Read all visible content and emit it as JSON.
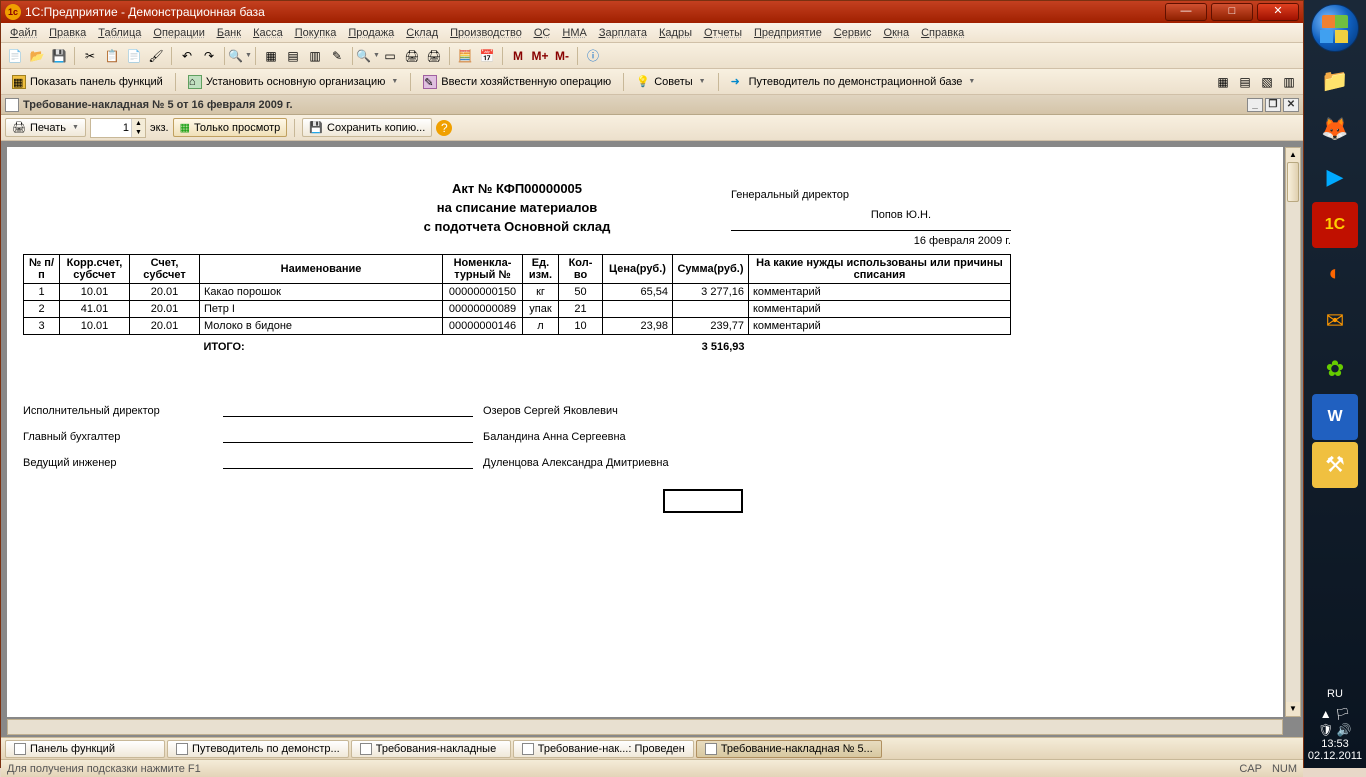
{
  "window": {
    "title": "1С:Предприятие - Демонстрационная база"
  },
  "menu": [
    "Файл",
    "Правка",
    "Таблица",
    "Операции",
    "Банк",
    "Касса",
    "Покупка",
    "Продажа",
    "Склад",
    "Производство",
    "ОС",
    "НМА",
    "Зарплата",
    "Кадры",
    "Отчеты",
    "Предприятие",
    "Сервис",
    "Окна",
    "Справка"
  ],
  "toolbar2": {
    "show_panel": "Показать панель функций",
    "set_org": "Установить основную организацию",
    "enter_op": "Ввести хозяйственную операцию",
    "tips": "Советы",
    "guide": "Путеводитель по демонстрационной базе"
  },
  "doc": {
    "tab_title": "Требование-накладная № 5 от 16 февраля 2009 г.",
    "print": "Печать",
    "copies": "1",
    "copies_suffix": "экз.",
    "view_only": "Только просмотр",
    "save_copy": "Сохранить копию..."
  },
  "act": {
    "number_line": "Акт № КФП00000005",
    "subtitle1": "на списание материалов",
    "subtitle2": "с подотчета Основной склад",
    "director_label": "Генеральный директор",
    "director_name": "Попов Ю.Н.",
    "date": "16 февраля 2009 г."
  },
  "table": {
    "headers": [
      "№ п/п",
      "Корр.счет, субсчет",
      "Счет, субсчет",
      "Наименование",
      "Номенкла-турный №",
      "Ед. изм.",
      "Кол-во",
      "Цена(руб.)",
      "Сумма(руб.)",
      "На какие нужды использованы или причины списания"
    ],
    "rows": [
      [
        "1",
        "10.01",
        "20.01",
        "Какао порошок",
        "00000000150",
        "кг",
        "50",
        "65,54",
        "3 277,16",
        "комментарий"
      ],
      [
        "2",
        "41.01",
        "20.01",
        "Петр I",
        "00000000089",
        "упак",
        "21",
        "",
        "",
        "комментарий"
      ],
      [
        "3",
        "10.01",
        "20.01",
        "Молоко в бидоне",
        "00000000146",
        "л",
        "10",
        "23,98",
        "239,77",
        "комментарий"
      ]
    ],
    "total_label": "ИТОГО:",
    "total_value": "3 516,93"
  },
  "signatures": [
    {
      "role": "Исполнительный директор",
      "name": "Озеров Сергей Яковлевич"
    },
    {
      "role": "Главный бухгалтер",
      "name": "Баландина Анна Сергеевна"
    },
    {
      "role": "Ведущий инженер",
      "name": "Дуленцова Александра Дмитриевна"
    }
  ],
  "taskbar": [
    {
      "label": "Панель функций",
      "active": false
    },
    {
      "label": "Путеводитель по демонстр...",
      "active": false
    },
    {
      "label": "Требования-накладные",
      "active": false
    },
    {
      "label": "Требование-нак...: Проведен",
      "active": false
    },
    {
      "label": "Требование-накладная № 5...",
      "active": true
    }
  ],
  "status": {
    "hint": "Для получения подсказки нажмите F1",
    "cap": "CAP",
    "num": "NUM"
  },
  "tray": {
    "lang": "RU",
    "time": "13:53",
    "date": "02.12.2011"
  }
}
